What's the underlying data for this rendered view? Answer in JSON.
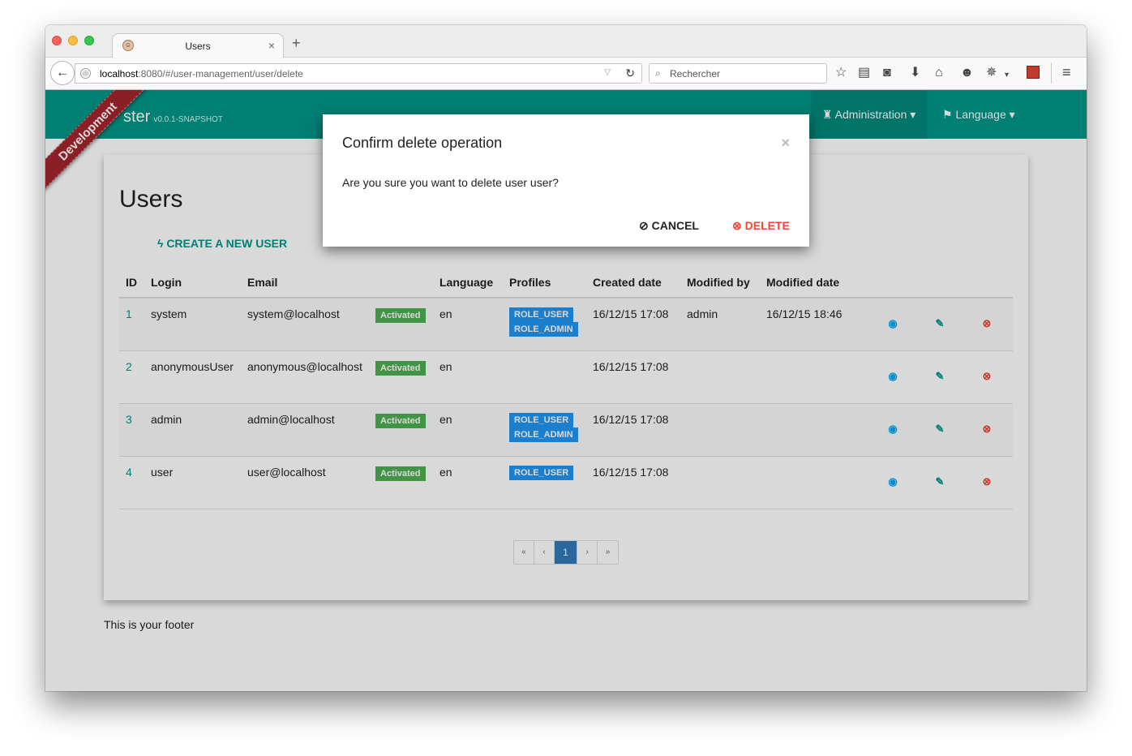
{
  "browser": {
    "tab_title": "Users",
    "tab_close": "×",
    "new_tab": "+",
    "url_host": "localhost",
    "url_rest": ":8080/#/user-management/user/delete",
    "search_placeholder": "Rechercher"
  },
  "app": {
    "brand": "ster",
    "version": "v0.0.1-SNAPSHOT",
    "ribbon": "Development",
    "nav": {
      "administration": "Administration",
      "language": "Language"
    }
  },
  "page": {
    "title": "Users",
    "create_button": "CREATE A NEW USER",
    "footer": "This is your footer"
  },
  "table": {
    "headers": [
      "ID",
      "Login",
      "Email",
      "",
      "Language",
      "Profiles",
      "Created date",
      "Modified by",
      "Modified date"
    ],
    "rows": [
      {
        "id": "1",
        "login": "system",
        "email": "system@localhost",
        "status": "Activated",
        "lang": "en",
        "profiles": [
          "ROLE_USER",
          "ROLE_ADMIN"
        ],
        "created": "16/12/15 17:08",
        "modified_by": "admin",
        "modified_date": "16/12/15 18:46"
      },
      {
        "id": "2",
        "login": "anonymousUser",
        "email": "anonymous@localhost",
        "status": "Activated",
        "lang": "en",
        "profiles": [],
        "created": "16/12/15 17:08",
        "modified_by": "",
        "modified_date": ""
      },
      {
        "id": "3",
        "login": "admin",
        "email": "admin@localhost",
        "status": "Activated",
        "lang": "en",
        "profiles": [
          "ROLE_USER",
          "ROLE_ADMIN"
        ],
        "created": "16/12/15 17:08",
        "modified_by": "",
        "modified_date": ""
      },
      {
        "id": "4",
        "login": "user",
        "email": "user@localhost",
        "status": "Activated",
        "lang": "en",
        "profiles": [
          "ROLE_USER"
        ],
        "created": "16/12/15 17:08",
        "modified_by": "",
        "modified_date": ""
      }
    ]
  },
  "pagination": {
    "first": "«",
    "prev": "‹",
    "current": "1",
    "next": "›",
    "last": "»"
  },
  "modal": {
    "title": "Confirm delete operation",
    "close": "×",
    "body": "Are you sure you want to delete user user?",
    "cancel": "CANCEL",
    "delete": "DELETE"
  },
  "colors": {
    "primary": "#009688",
    "danger": "#f44336",
    "info": "#2196f3",
    "success": "#4caf50",
    "ribbon": "#a3252c"
  }
}
